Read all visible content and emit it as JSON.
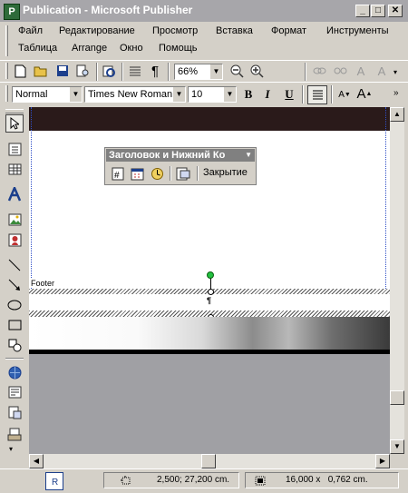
{
  "window": {
    "title": "Publication - Microsoft Publisher"
  },
  "menu": [
    "Файл",
    "Редактирование",
    "Просмотр",
    "Вставка",
    "Формат",
    "Инструменты",
    "Таблица",
    "Arrange",
    "Окно",
    "Помощь"
  ],
  "toolbar": {
    "zoom": "66%"
  },
  "format_bar": {
    "style": "Normal",
    "font": "Times New Roman",
    "size": "10",
    "bold": "B",
    "italic": "I",
    "underline": "U"
  },
  "floating_toolbar": {
    "title": "Заголовок и Нижний Ко",
    "close_label": "Закрытие"
  },
  "page": {
    "footer_label": "Footer"
  },
  "status": {
    "page_label": "R",
    "position": "2,500; 27,200 cm.",
    "size": "16,000 x   0,762 cm."
  },
  "colors": {
    "title_bar": "#a7a6aa",
    "chrome": "#d4d0c8",
    "workspace": "#a0a0a4"
  }
}
